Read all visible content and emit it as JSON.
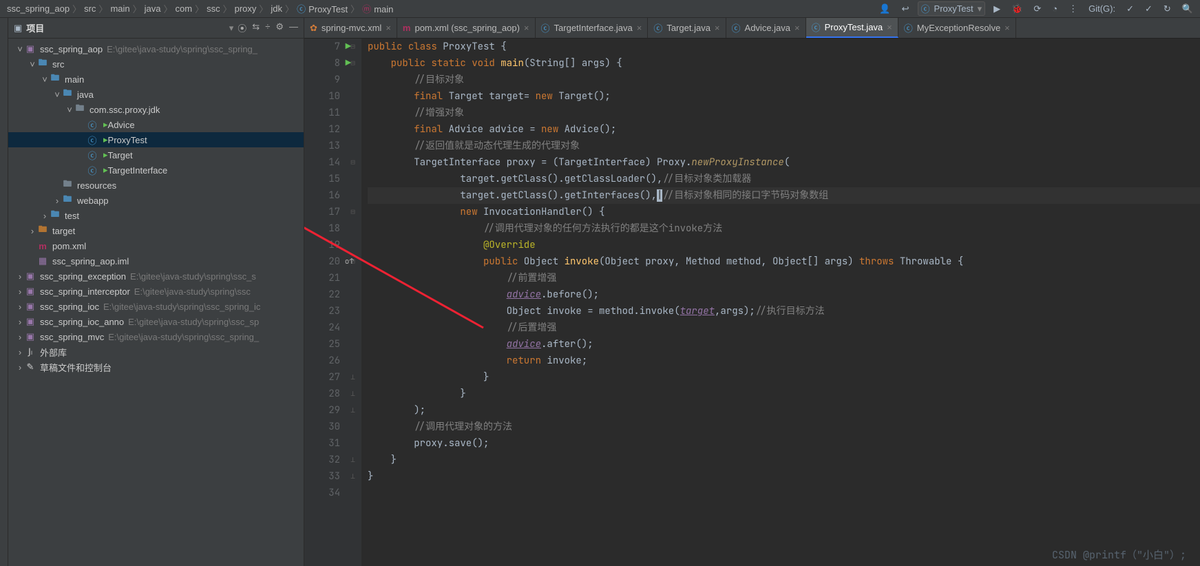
{
  "topbar": {
    "breadcrumbs": [
      "ssc_spring_aop",
      "src",
      "main",
      "java",
      "com",
      "ssc",
      "proxy",
      "jdk",
      "ProxyTest",
      "main"
    ],
    "run_config": "ProxyTest",
    "git_label": "Git(G):"
  },
  "project_panel": {
    "title": "项目",
    "tree": [
      {
        "d": 0,
        "a": "v",
        "i": "module",
        "label": "ssc_spring_aop",
        "path": "E:\\gitee\\java-study\\spring\\ssc_spring_"
      },
      {
        "d": 1,
        "a": "v",
        "i": "folder-src",
        "label": "src"
      },
      {
        "d": 2,
        "a": "v",
        "i": "folder-src",
        "label": "main"
      },
      {
        "d": 3,
        "a": "v",
        "i": "folder-src",
        "label": "java"
      },
      {
        "d": 4,
        "a": "v",
        "i": "folder",
        "label": "com.ssc.proxy.jdk"
      },
      {
        "d": 5,
        "a": "",
        "i": "class-run",
        "label": "Advice",
        "sel": false
      },
      {
        "d": 5,
        "a": "",
        "i": "class-run",
        "label": "ProxyTest",
        "sel": true
      },
      {
        "d": 5,
        "a": "",
        "i": "class-run",
        "label": "Target"
      },
      {
        "d": 5,
        "a": "",
        "i": "class-run",
        "label": "TargetInterface"
      },
      {
        "d": 3,
        "a": "",
        "i": "folder",
        "label": "resources"
      },
      {
        "d": 3,
        "a": ">",
        "i": "folder-src",
        "label": "webapp"
      },
      {
        "d": 2,
        "a": ">",
        "i": "folder-src",
        "label": "test"
      },
      {
        "d": 1,
        "a": ">",
        "i": "folder-target",
        "label": "target"
      },
      {
        "d": 1,
        "a": "",
        "i": "m",
        "label": "pom.xml"
      },
      {
        "d": 1,
        "a": "",
        "i": "iml",
        "label": "ssc_spring_aop.iml"
      },
      {
        "d": 0,
        "a": ">",
        "i": "module",
        "label": "ssc_spring_exception",
        "path": "E:\\gitee\\java-study\\spring\\ssc_s"
      },
      {
        "d": 0,
        "a": ">",
        "i": "module",
        "label": "ssc_spring_interceptor",
        "path": "E:\\gitee\\java-study\\spring\\ssc"
      },
      {
        "d": 0,
        "a": ">",
        "i": "module",
        "label": "ssc_spring_ioc",
        "path": "E:\\gitee\\java-study\\spring\\ssc_spring_ic"
      },
      {
        "d": 0,
        "a": ">",
        "i": "module",
        "label": "ssc_spring_ioc_anno",
        "path": "E:\\gitee\\java-study\\spring\\ssc_sp"
      },
      {
        "d": 0,
        "a": ">",
        "i": "module",
        "label": "ssc_spring_mvc",
        "path": "E:\\gitee\\java-study\\spring\\ssc_spring_"
      },
      {
        "d": 0,
        "a": ">",
        "i": "libs",
        "label": "外部库"
      },
      {
        "d": 0,
        "a": ">",
        "i": "scratches",
        "label": "草稿文件和控制台"
      }
    ]
  },
  "tabs": [
    {
      "icon": "xml",
      "label": "spring-mvc.xml"
    },
    {
      "icon": "m",
      "label": "pom.xml (ssc_spring_aop)"
    },
    {
      "icon": "c",
      "label": "TargetInterface.java"
    },
    {
      "icon": "c",
      "label": "Target.java"
    },
    {
      "icon": "c",
      "label": "Advice.java"
    },
    {
      "icon": "c",
      "label": "ProxyTest.java",
      "active": true
    },
    {
      "icon": "c",
      "label": "MyExceptionResolve"
    }
  ],
  "code": {
    "first_line": 7,
    "lines": [
      {
        "n": 7,
        "run": true,
        "html": "<span class='kw'>public</span> <span class='kw'>class</span> <span class='cls'>ProxyTest</span> {"
      },
      {
        "n": 8,
        "run": true,
        "html": "    <span class='kw'>public</span> <span class='kw'>static</span> <span class='kw'>void</span> <span class='fn'>main</span>(String[] args) {"
      },
      {
        "n": 9,
        "html": "        <span class='cmt'>//目标对象</span>"
      },
      {
        "n": 10,
        "html": "        <span class='kw'>final</span> Target target= <span class='kw'>new</span> Target();"
      },
      {
        "n": 11,
        "html": "        <span class='cmt'>//增强对象</span>"
      },
      {
        "n": 12,
        "html": "        <span class='kw'>final</span> Advice advice = <span class='kw'>new</span> Advice();"
      },
      {
        "n": 13,
        "html": "        <span class='cmt'>//返回值就是动态代理生成的代理对象</span>"
      },
      {
        "n": 14,
        "html": "        TargetInterface proxy = (TargetInterface) Proxy.<span class='fni'>newProxyInstance</span>("
      },
      {
        "n": 15,
        "html": "                target.getClass().getClassLoader(),<span class='cmt'>//目标对象类加载器</span>"
      },
      {
        "n": 16,
        "hl": true,
        "html": "                target.getClass().getInterfaces(),<span class='caret'>|</span><span class='cmt'>//目标对象相同的接口字节码对象数组</span>"
      },
      {
        "n": 17,
        "html": "                <span class='kw'>new</span> InvocationHandler() {"
      },
      {
        "n": 18,
        "html": "                    <span class='cmt'>//调用代理对象的任何方法执行的都是这个invoke方法</span>"
      },
      {
        "n": 19,
        "html": "                    <span class='ann'>@Override</span>"
      },
      {
        "n": 20,
        "ov": true,
        "html": "                    <span class='kw'>public</span> Object <span class='fn'>invoke</span>(Object proxy, Method method, Object[] args) <span class='kw'>throws</span> Throwable {"
      },
      {
        "n": 21,
        "html": "                        <span class='cmt'>//前置增强</span>"
      },
      {
        "n": 22,
        "html": "                        <span class='var u'>advice</span>.before();"
      },
      {
        "n": 23,
        "html": "                        Object invoke = method.invoke(<span class='var u'>target</span>,args);<span class='cmt'>//执行目标方法</span>"
      },
      {
        "n": 24,
        "html": "                        <span class='cmt'>//后置增强</span>"
      },
      {
        "n": 25,
        "html": "                        <span class='var u'>advice</span>.after();"
      },
      {
        "n": 26,
        "html": "                        <span class='kw'>return</span> invoke;"
      },
      {
        "n": 27,
        "html": "                    }"
      },
      {
        "n": 28,
        "html": "                }"
      },
      {
        "n": 29,
        "html": "        );"
      },
      {
        "n": 30,
        "html": "        <span class='cmt'>//调用代理对象的方法</span>"
      },
      {
        "n": 31,
        "html": "        proxy.save();"
      },
      {
        "n": 32,
        "html": "    }"
      },
      {
        "n": 33,
        "html": "}"
      },
      {
        "n": 34,
        "html": ""
      }
    ]
  },
  "watermark": "CSDN @printf（\"小白\"）;"
}
